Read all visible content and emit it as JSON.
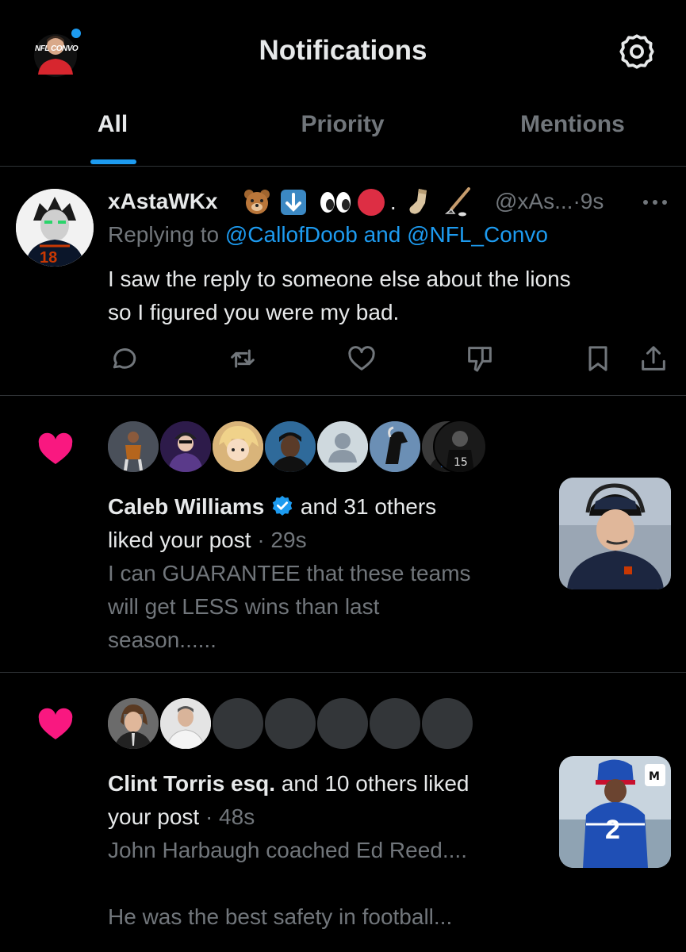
{
  "header": {
    "title": "Notifications",
    "avatar_text": "NFL CONVO"
  },
  "tabs": [
    {
      "label": "All",
      "active": true
    },
    {
      "label": "Priority",
      "active": false
    },
    {
      "label": "Mentions",
      "active": false
    }
  ],
  "reply": {
    "display_name": "xAstaWKx",
    "handle": "@xAs...",
    "time": "·9s",
    "replying_prefix": "Replying to ",
    "replying_targets": "@CallofDoob and @NFL_Convo",
    "text_line1": "I saw the reply to someone else about the lions",
    "text_line2": "so I figured you were my bad.",
    "avatar_jersey": "18"
  },
  "notifications": [
    {
      "actor": "Caleb Williams",
      "verified": true,
      "rest_line1": " and 31 others",
      "line2": "liked your post",
      "time": " · 29s",
      "snippet_line1": "I can GUARANTEE that these teams",
      "snippet_line2": "will get LESS wins than last",
      "snippet_line3": "season......"
    },
    {
      "actor": "Clint Torris esq.",
      "verified": false,
      "rest_line1": " and 10 others liked",
      "line2": "your post",
      "time": " · 48s",
      "snippet_line1": "John Harbaugh coached Ed Reed....",
      "snippet_line3": "He was the best safety in football...",
      "thumb_jersey": "2"
    }
  ],
  "colors": {
    "accent": "#1d9bf0",
    "like": "#f91880",
    "muted": "#71767b",
    "text": "#e7e9ea",
    "divider": "#2f3336"
  }
}
